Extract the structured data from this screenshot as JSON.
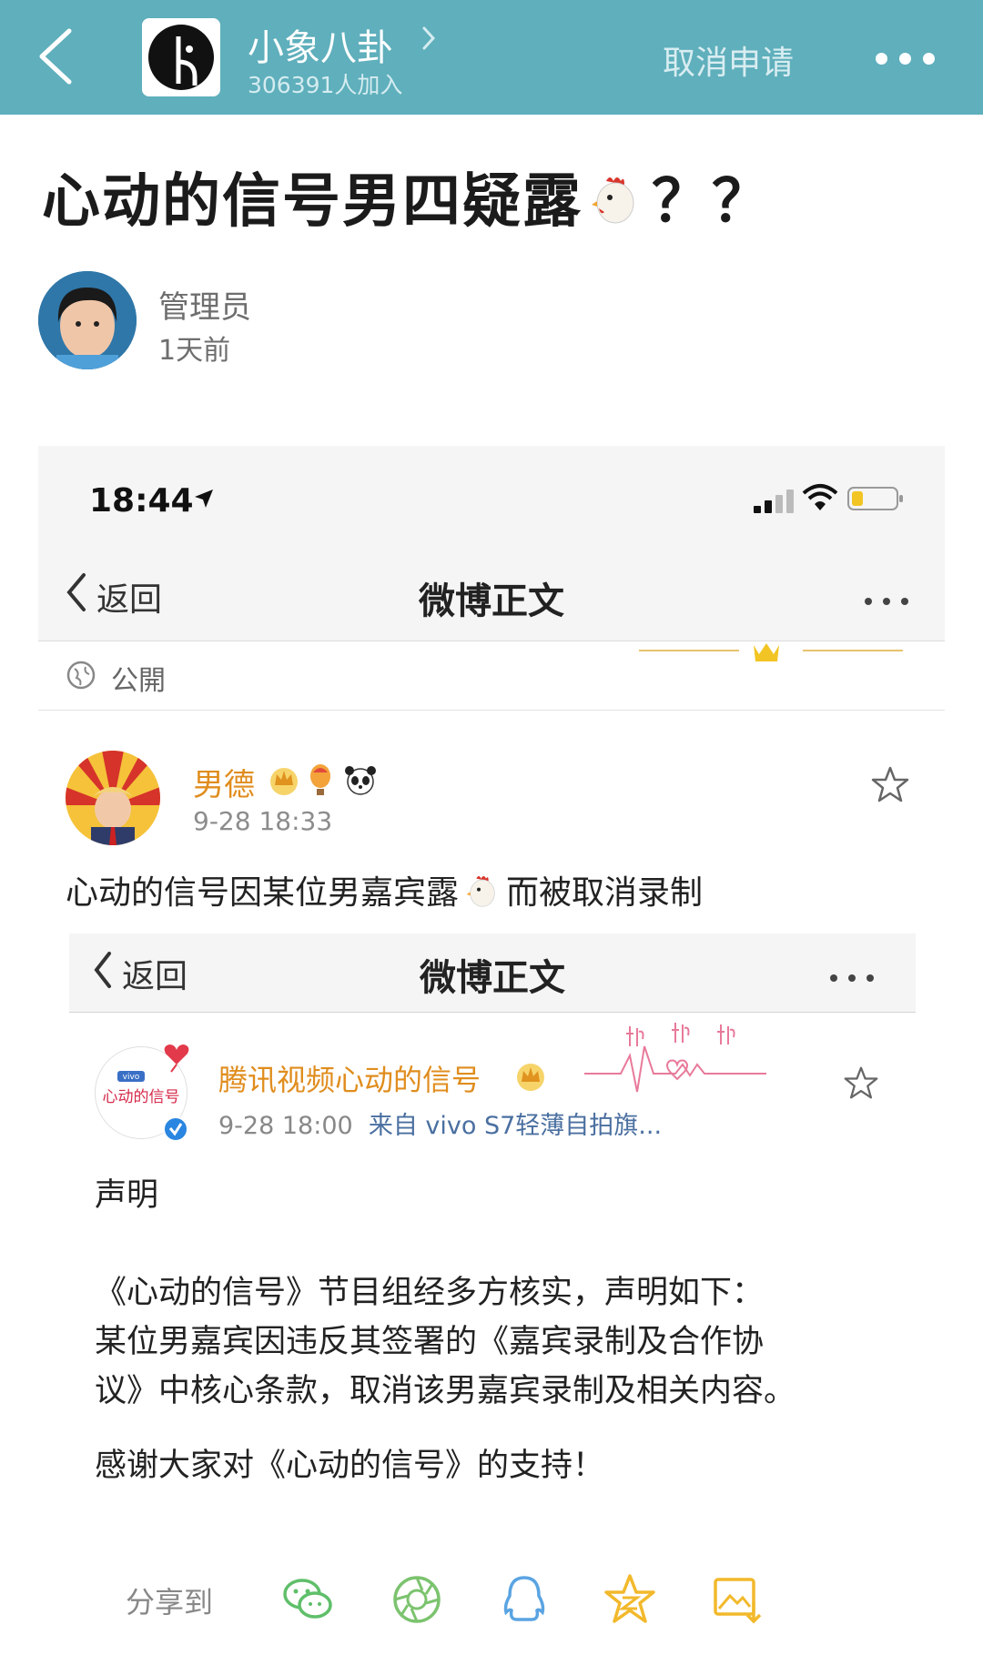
{
  "app": {
    "group_name": "小象八卦",
    "member_count": "306391人加入",
    "cancel_label": "取消申请"
  },
  "post": {
    "title_before": "心动的信号男四疑露",
    "title_after": "？？",
    "author": "管理员",
    "time": "1天前"
  },
  "screenshot": {
    "clock": "18:44",
    "nav_back": "返回",
    "nav_title": "微博正文",
    "visibility": "公開",
    "weibo_post": {
      "user": "男德",
      "time": "9-28 18:33",
      "text_before": "心动的信号因某位男嘉宾露",
      "text_after": "而被取消录制"
    },
    "inner": {
      "nav_back": "返回",
      "nav_title": "微博正文",
      "user": "腾讯视频心动的信号",
      "meta_time": "9-28 18:00",
      "meta_source": "来自 vivo S7轻薄自拍旗...",
      "avatar_text": "心动的信号",
      "avatar_brand": "vivo",
      "statement_title": "声明",
      "statement_lines": [
        "《心动的信号》节目组经多方核实，声明如下：",
        "某位男嘉宾因违反其签署的《嘉宾录制及合作协",
        "议》中核心条款，取消该男嘉宾录制及相关内容。"
      ],
      "thanks": "感谢大家对《心动的信号》的支持！",
      "share_label": "分享到"
    }
  },
  "colors": {
    "header_bg": "#5fafbc",
    "vip_name": "#e08d1e",
    "share_wechat": "#5fbf6a",
    "share_moments": "#7cc36f",
    "share_qq": "#5aa4e2",
    "share_qzone": "#f2b92c"
  },
  "icons": [
    "back-arrow-icon",
    "group-logo-icon",
    "chevron-right-icon",
    "more-icon",
    "chicken-emoji-icon",
    "location-arrow-icon",
    "signal-icon",
    "wifi-icon",
    "battery-icon",
    "globe-icon",
    "crown-icon",
    "balloon-icon",
    "panda-icon",
    "star-icon",
    "verified-icon",
    "wechat-icon",
    "moments-icon",
    "qq-icon",
    "qzone-icon",
    "save-image-icon"
  ]
}
